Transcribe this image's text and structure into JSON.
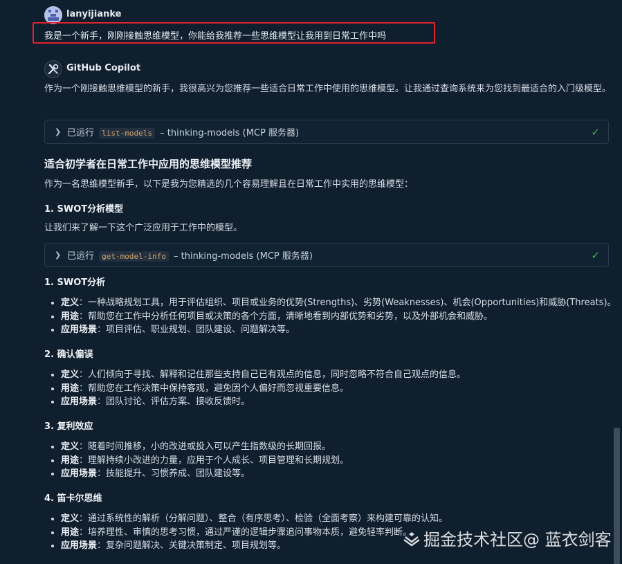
{
  "user": {
    "name": "lanyijianke",
    "message": "我是一个新手，刚刚接触思维模型，你能给我推荐一些思维模型让我用到日常工作中吗"
  },
  "bot": {
    "name": "GitHub Copilot",
    "intro": "作为一个刚接触思维模型的新手，我很高兴为您推荐一些适合日常工作中使用的思维模型。让我通过查询系统来为您找到最适合的入门级模型。"
  },
  "tool_calls": [
    {
      "prefix": "已运行",
      "tool": "list-models",
      "suffix": "– thinking-models (MCP 服务器)"
    },
    {
      "prefix": "已运行",
      "tool": "get-model-info",
      "suffix": "– thinking-models (MCP 服务器)"
    }
  ],
  "content": {
    "heading": "适合初学者在日常工作中应用的思维模型推荐",
    "lead": "作为一名思维模型新手，以下是我为您精选的几个容易理解且在日常工作中实用的思维模型：",
    "section1_title": "1. SWOT分析模型",
    "section1_text": "让我们来了解一下这个广泛应用于工作中的模型。",
    "models": [
      {
        "title": "1. SWOT分析",
        "items": [
          {
            "label": "定义",
            "text": "：一种战略规划工具，用于评估组织、项目或业务的优势(Strengths)、劣势(Weaknesses)、机会(Opportunities)和威胁(Threats)。"
          },
          {
            "label": "用途",
            "text": "：帮助您在工作中分析任何项目或决策的各个方面，清晰地看到内部优势和劣势，以及外部机会和威胁。"
          },
          {
            "label": "应用场景",
            "text": "：项目评估、职业规划、团队建设、问题解决等。"
          }
        ]
      },
      {
        "title": "2. 确认偏误",
        "items": [
          {
            "label": "定义",
            "text": "：人们倾向于寻找、解释和记住那些支持自己已有观点的信息，同时忽略不符合自己观点的信息。"
          },
          {
            "label": "用途",
            "text": "：帮助您在工作决策中保持客观，避免因个人偏好而忽视重要信息。"
          },
          {
            "label": "应用场景",
            "text": "：团队讨论、评估方案、接收反馈时。"
          }
        ]
      },
      {
        "title": "3. 复利效应",
        "items": [
          {
            "label": "定义",
            "text": "：随着时间推移，小的改进或投入可以产生指数级的长期回报。"
          },
          {
            "label": "用途",
            "text": "：理解持续小改进的力量，应用于个人成长、项目管理和长期规划。"
          },
          {
            "label": "应用场景",
            "text": "：技能提升、习惯养成、团队建设等。"
          }
        ]
      },
      {
        "title": "4. 笛卡尔思维",
        "items": [
          {
            "label": "定义",
            "text": "：通过系统性的解析（分解问题）、整合（有序思考）、检验（全面考察）来构建可靠的认知。"
          },
          {
            "label": "用途",
            "text": "：培养理性、审慎的思考习惯，通过严谨的逻辑步骤追问事物本质，避免轻率判断。"
          },
          {
            "label": "应用场景",
            "text": "：复杂问题解决、关键决策制定、项目规划等。"
          }
        ]
      }
    ]
  },
  "watermark": "掘金技术社区@ 蓝衣剑客",
  "colors": {
    "background": "#0f1f2e",
    "highlight": "#e0232d",
    "check": "#3fb950"
  },
  "icons": {
    "user_avatar": "user-avatar-icon",
    "copilot": "copilot-tools-icon",
    "expand": "chevron-right-icon",
    "done": "checkmark-icon"
  }
}
